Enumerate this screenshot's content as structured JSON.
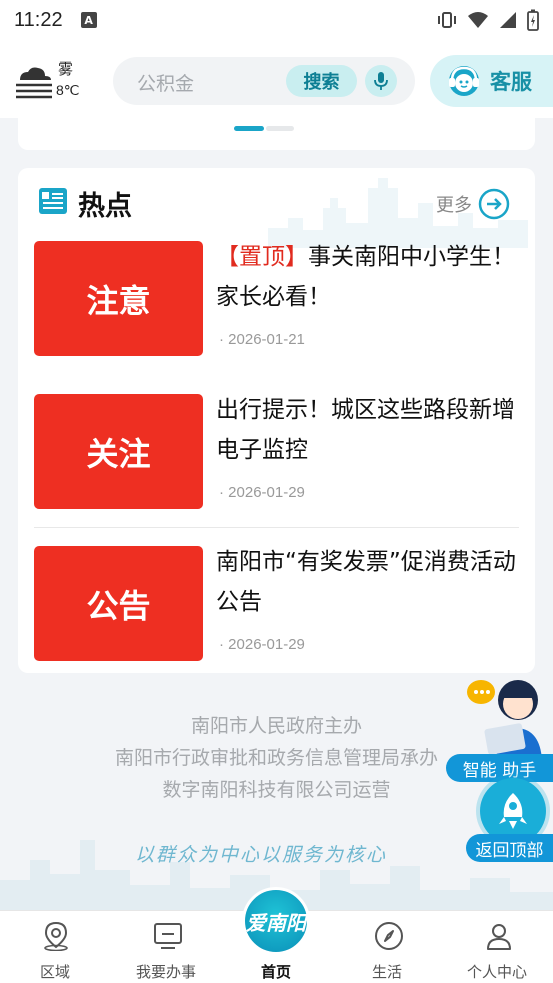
{
  "status_bar": {
    "time": "11:22",
    "notification_icon": "a-badge-icon",
    "icons": [
      "vibrate-icon",
      "wifi-icon",
      "signal-icon",
      "battery-charging-icon"
    ]
  },
  "header": {
    "weather": {
      "condition": "雾",
      "temperature": "8℃",
      "icon": "fog-icon"
    },
    "search": {
      "placeholder": "公积金",
      "button_label": "搜索",
      "mic_icon": "microphone-icon"
    },
    "service": {
      "label": "客服",
      "icon": "headset-icon"
    }
  },
  "hot": {
    "title": "热点",
    "more_label": "更多",
    "items": [
      {
        "thumb_text": "注意",
        "pin_tag": "【置顶】",
        "title": "事关南阳中小学生！家长必看！",
        "date": "· 2026-01-21"
      },
      {
        "thumb_text": "关注",
        "pin_tag": "",
        "title": "出行提示！城区这些路段新增电子监控",
        "date": "· 2026-01-29"
      },
      {
        "thumb_text": "公告",
        "pin_tag": "",
        "title": "南阳市“有奖发票”促消费活动公告",
        "date": "· 2026-01-29"
      }
    ]
  },
  "footer": {
    "lines": [
      "南阳市人民政府主办",
      "南阳市行政审批和政务信息管理局承办",
      "数字南阳科技有限公司运营"
    ],
    "slogan": "以群众为中心以服务为核心"
  },
  "floating": {
    "assistant_label": "智能 助手",
    "back_top_label": "返回顶部"
  },
  "bottom_nav": {
    "items": [
      {
        "label": "区域",
        "icon": "location-pin-icon"
      },
      {
        "label": "我要办事",
        "icon": "monitor-icon"
      },
      {
        "label": "首页",
        "icon": "home-logo-icon",
        "logo_text": "爱南阳"
      },
      {
        "label": "生活",
        "icon": "compass-icon"
      },
      {
        "label": "个人中心",
        "icon": "user-icon"
      }
    ]
  },
  "colors": {
    "accent": "#1aa5c8",
    "thumb_red": "#ee2f22",
    "pin_red": "#e12b1f"
  }
}
